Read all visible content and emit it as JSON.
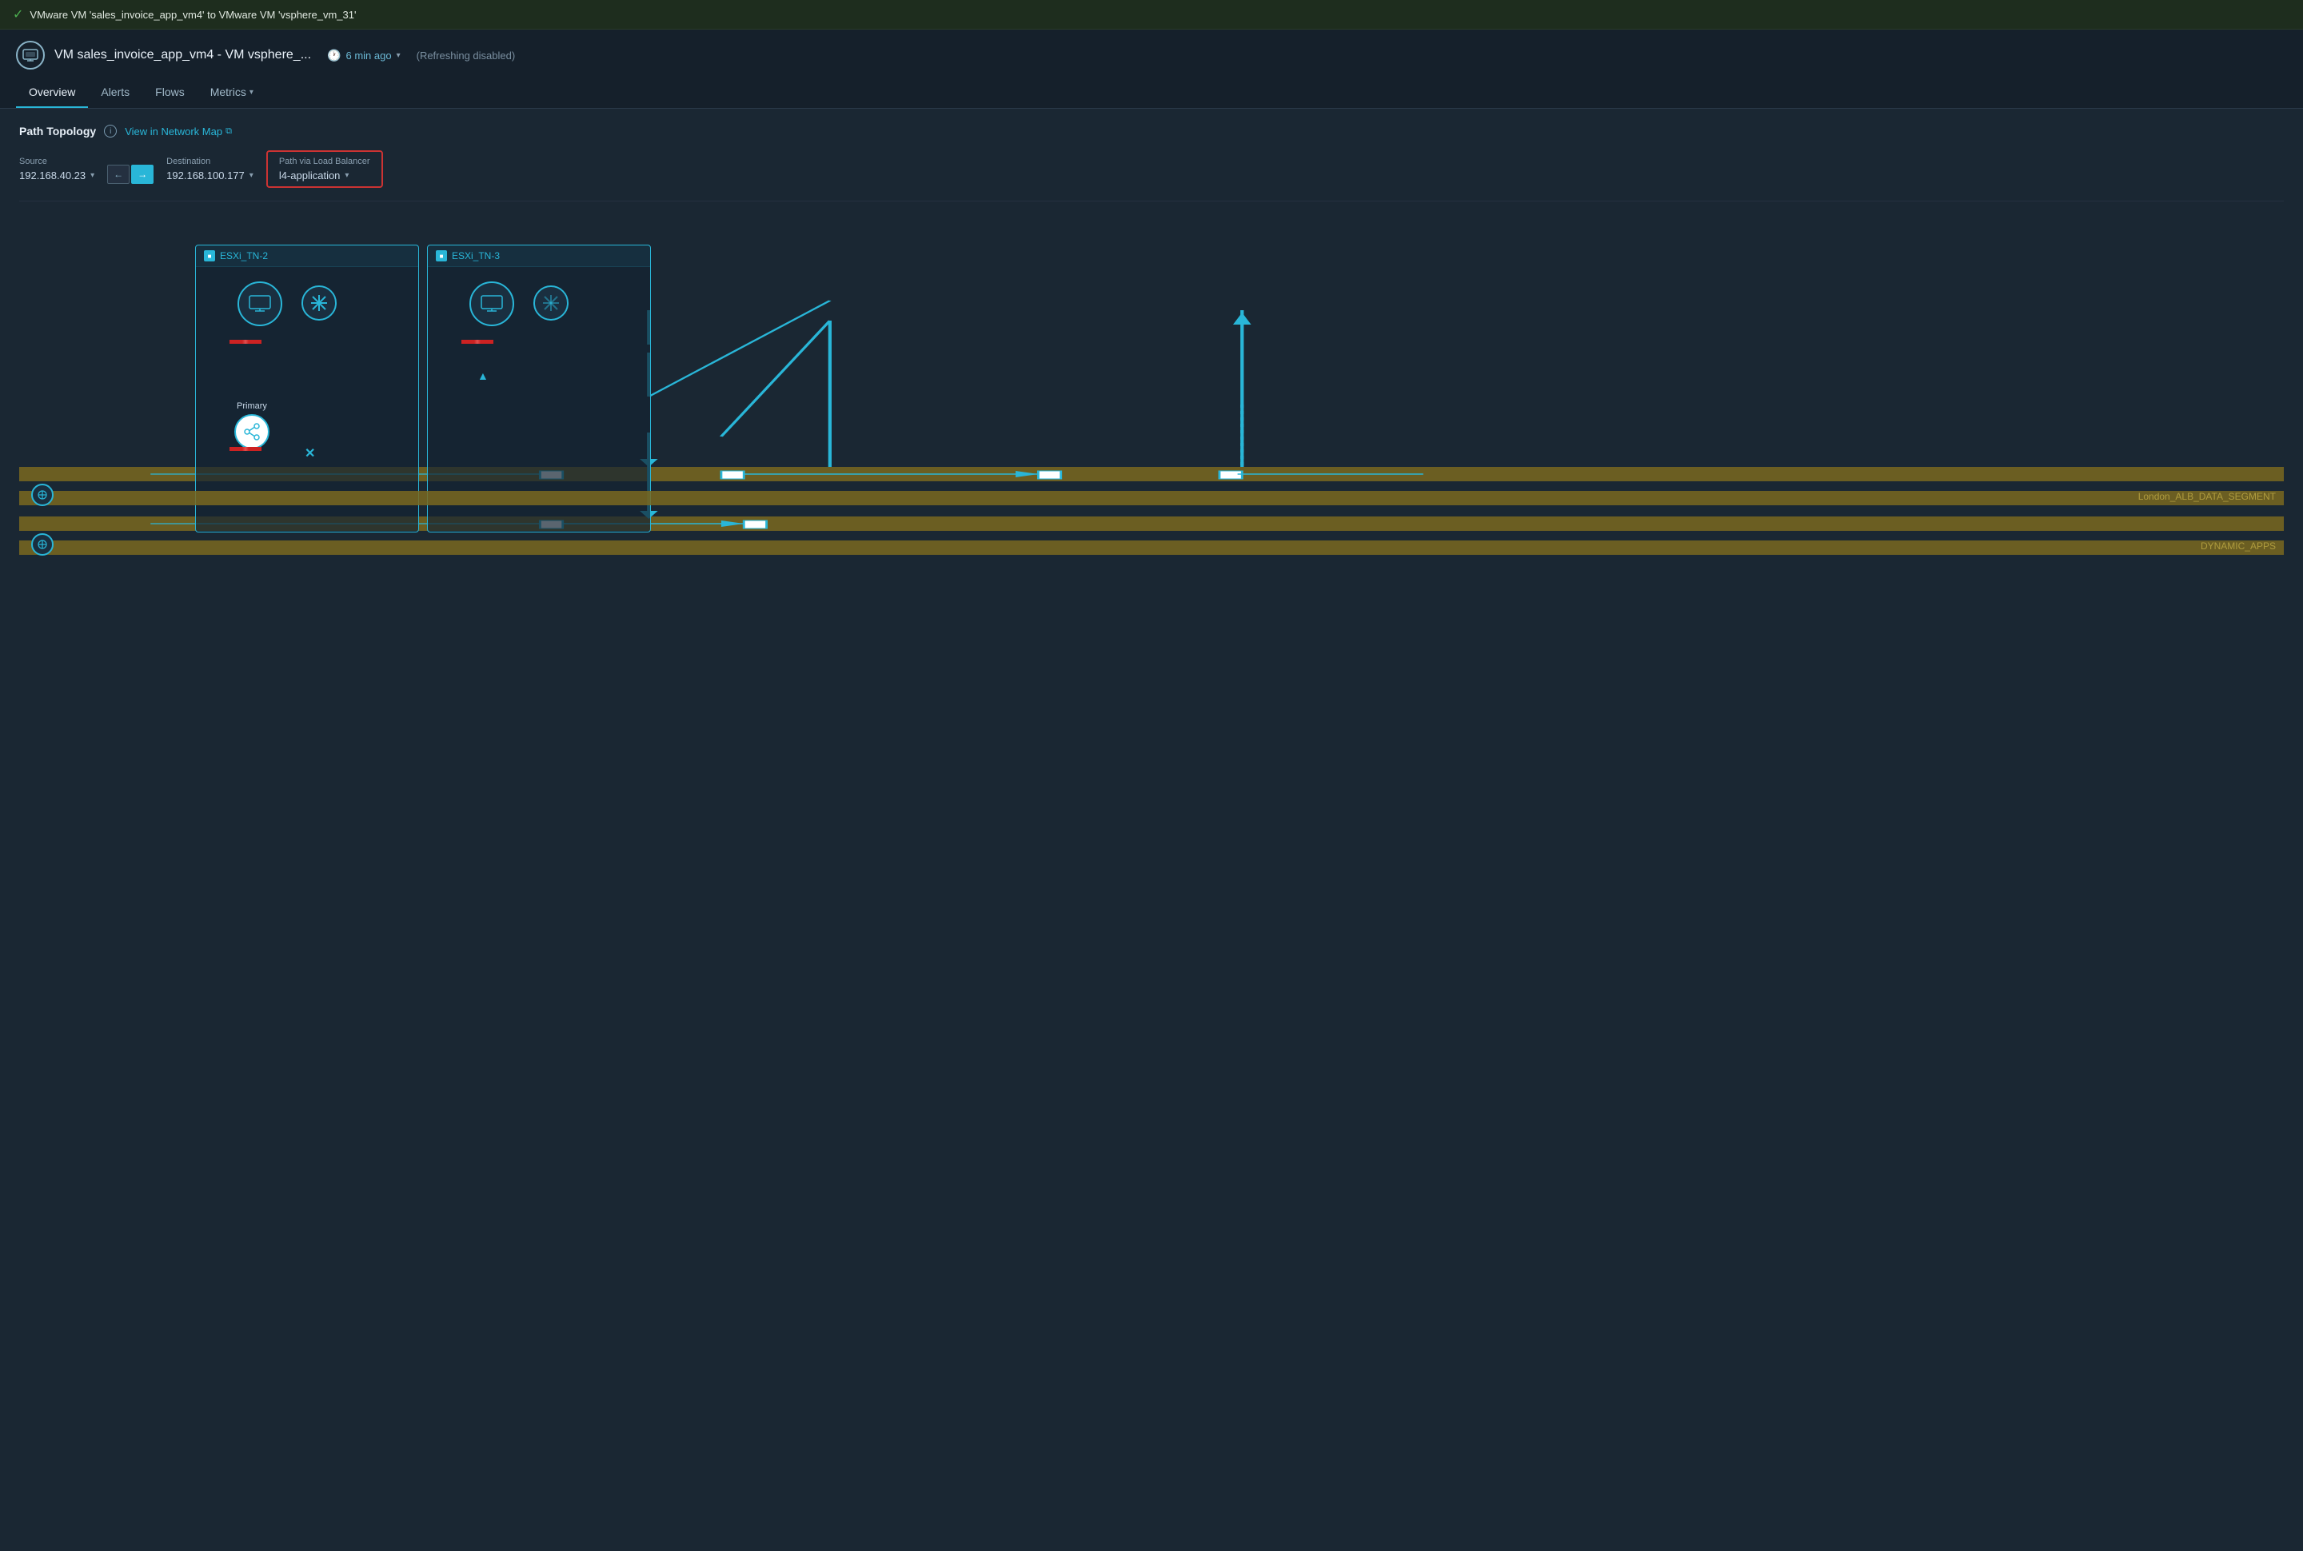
{
  "topBar": {
    "checkIcon": "✓",
    "text": "VMware VM 'sales_invoice_app_vm4' to VMware VM 'vsphere_vm_31'"
  },
  "header": {
    "vmIconText": "⊡",
    "title": "VM sales_invoice_app_vm4 - VM vsphere_...",
    "timeAgo": "6 min ago",
    "refreshing": "(Refreshing  disabled)"
  },
  "tabs": [
    {
      "label": "Overview",
      "active": true
    },
    {
      "label": "Alerts",
      "active": false
    },
    {
      "label": "Flows",
      "active": false
    },
    {
      "label": "Metrics",
      "active": false,
      "hasChevron": true
    }
  ],
  "pathTopology": {
    "sectionTitle": "Path Topology",
    "infoLabel": "i",
    "networkMapLink": "View in Network Map",
    "externalLinkIcon": "↗"
  },
  "controls": {
    "sourceLabel": "Source",
    "sourceValue": "192.168.40.23",
    "arrowLeft": "←",
    "arrowRight": "→",
    "destinationLabel": "Destination",
    "destinationValue": "192.168.100.177",
    "pathViaLabel": "Path via Load Balancer",
    "pathViaValue": "l4-application"
  },
  "topology": {
    "esxiBoxes": [
      {
        "id": "esxi-tn-2",
        "label": "ESXi_TN-2"
      },
      {
        "id": "esxi-tn-3",
        "label": "ESXi_TN-3"
      }
    ],
    "segments": [
      {
        "id": "seg1",
        "label": "London_ALB_DATA_SEGMENT"
      },
      {
        "id": "seg2",
        "label": "DYNAMIC_APPS"
      }
    ],
    "nodes": {
      "vmNode1Label": "⊡",
      "vmNode2Label": "⊡",
      "snowflake1": "❄",
      "snowflake2": "❄",
      "shareLabel": "Primary",
      "shareIcon": "⟲"
    }
  }
}
